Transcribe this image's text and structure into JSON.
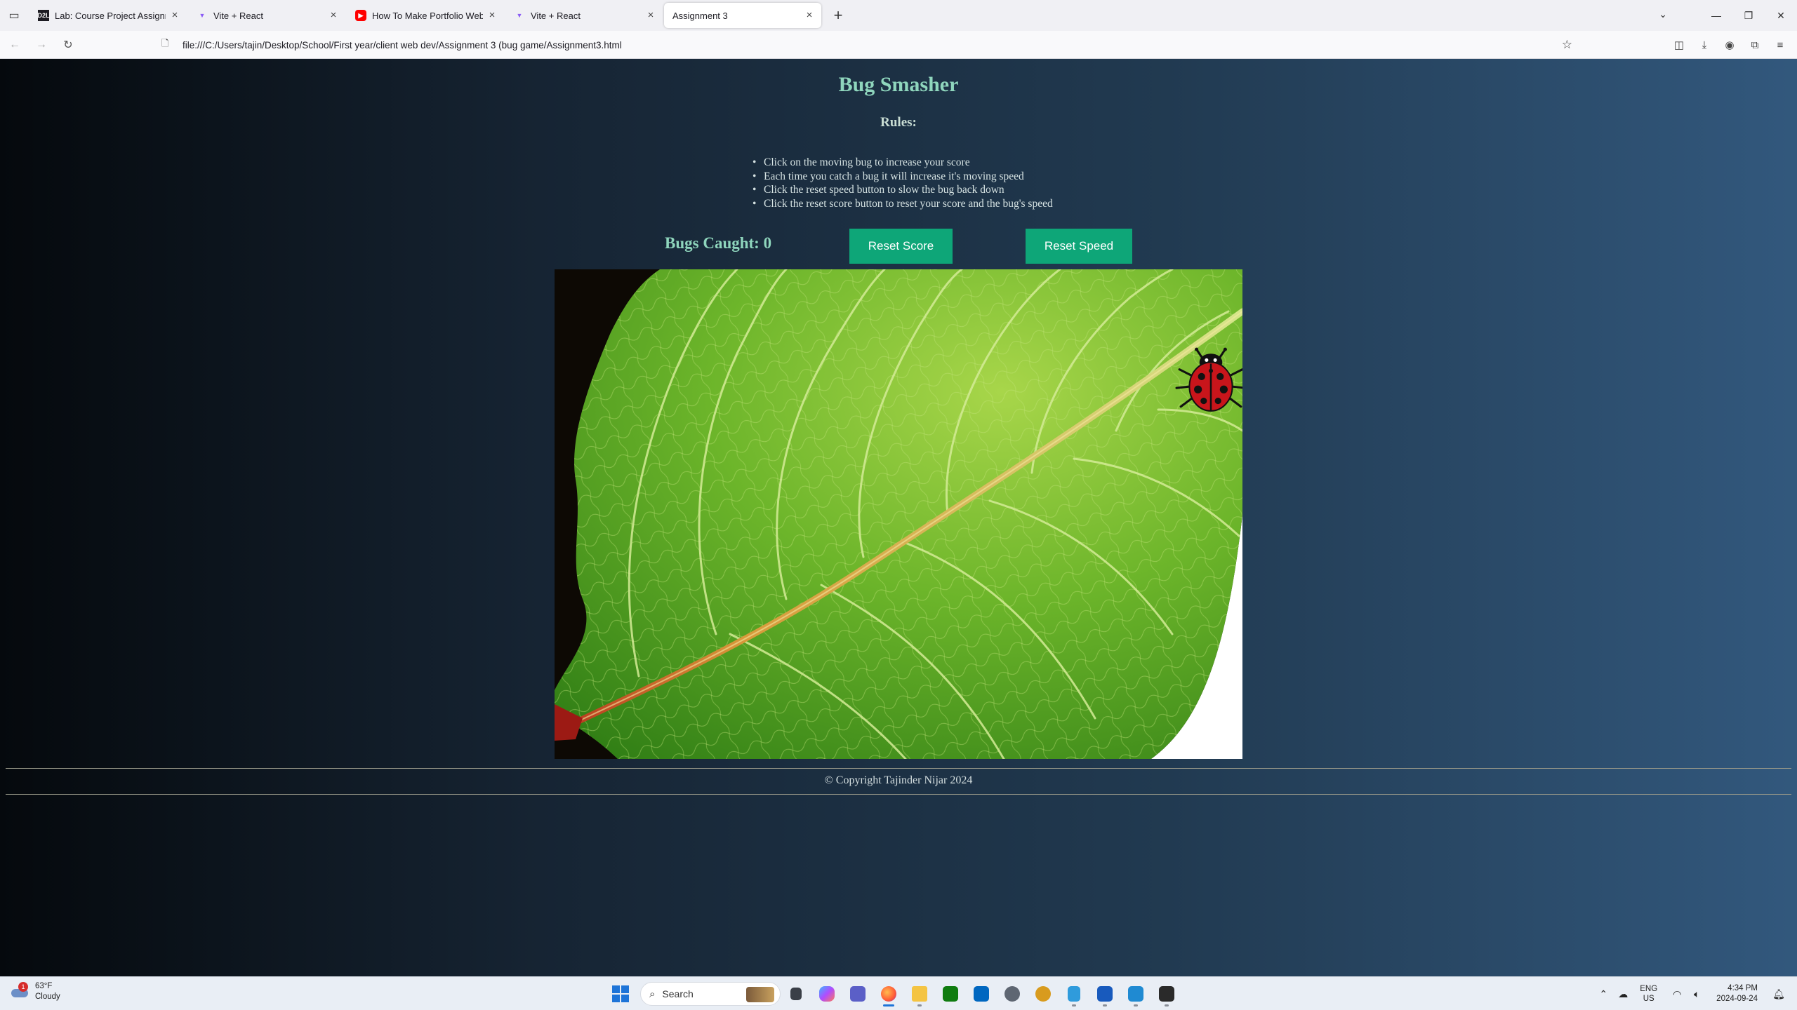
{
  "browser": {
    "tabs": [
      {
        "title": "Lab: Course Project Assignment",
        "favicon": "lab-icon",
        "active": false
      },
      {
        "title": "Vite + React",
        "favicon": "vite-icon",
        "active": false
      },
      {
        "title": "How To Make Portfolio Website",
        "favicon": "youtube-icon",
        "active": false
      },
      {
        "title": "Vite + React",
        "favicon": "vite-icon",
        "active": false
      },
      {
        "title": "Assignment 3",
        "favicon": "none",
        "active": true
      }
    ],
    "url": "file:///C:/Users/tajin/Desktop/School/First year/client web dev/Assignment 3 (bug game/Assignment3.html"
  },
  "game": {
    "title": "Bug Smasher",
    "rules_heading": "Rules:",
    "rules": [
      "Click on the moving bug to increase your score",
      "Each time you catch a bug it will increase it's moving speed",
      "Click the reset speed button to slow the bug back down",
      "Click the reset score button to reset your score and the bug's speed"
    ],
    "score_text": "Bugs Caught: 0",
    "reset_score_label": "Reset Score",
    "reset_speed_label": "Reset Speed",
    "footer": "© Copyright Tajinder Nijar 2024"
  },
  "taskbar": {
    "weather_temp": "63°F",
    "weather_desc": "Cloudy",
    "weather_badge": "1",
    "search_placeholder": "Search",
    "lang_top": "ENG",
    "lang_bottom": "US",
    "time": "4:34 PM",
    "date": "2024-09-24"
  },
  "colors": {
    "title": "#8fd6bd",
    "button": "#0ea678",
    "leaf": "#6cb52a",
    "ladybug": "#c8151b"
  }
}
